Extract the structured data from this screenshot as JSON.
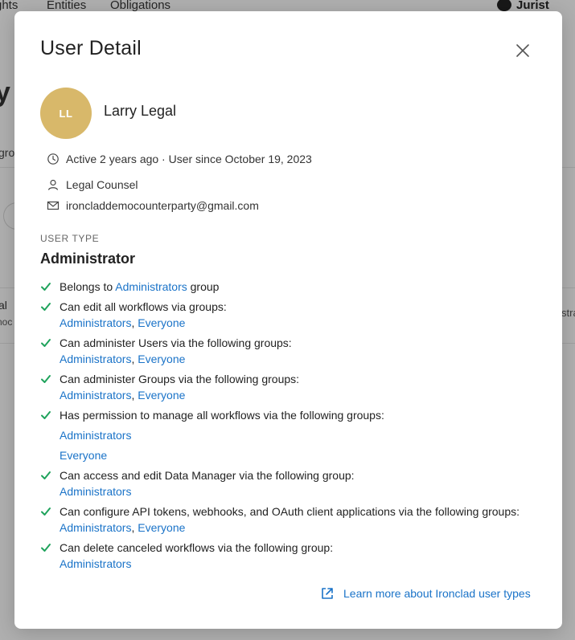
{
  "background": {
    "nav_tabs": [
      "ghts",
      "Entities",
      "Obligations"
    ],
    "account_label": "Jurist",
    "heading_fragment": "y",
    "tab_fragment": "gro",
    "row_label_fragment": "al",
    "row_sub_fragment": "noc",
    "row_right_fragment": "stra"
  },
  "modal": {
    "title": "User Detail",
    "close_icon": "close-icon",
    "user": {
      "initials": "LL",
      "name": "Larry Legal",
      "avatar_color": "#d8b86a",
      "activity": "Active 2 years ago · User since October 19, 2023",
      "role": "Legal Counsel",
      "email": "ironcladdemocounterparty@gmail.com"
    },
    "user_type_label": "USER TYPE",
    "user_type": "Administrator",
    "permissions": [
      {
        "prefix": "Belongs to ",
        "inline_link": "Administrators",
        "suffix": " group"
      },
      {
        "text": "Can edit all workflows via groups:",
        "links": [
          "Administrators",
          "Everyone"
        ]
      },
      {
        "text": "Can administer Users via the following groups:",
        "links": [
          "Administrators",
          "Everyone"
        ]
      },
      {
        "text": "Can administer Groups via the following groups:",
        "links": [
          "Administrators",
          "Everyone"
        ]
      },
      {
        "text": "Has permission to manage all workflows via the following groups:",
        "block_links": [
          "Administrators",
          "Everyone"
        ]
      },
      {
        "text": "Can access and edit Data Manager via the following group:",
        "links": [
          "Administrators"
        ]
      },
      {
        "text": "Can configure API tokens, webhooks, and OAuth client applications via the following groups:",
        "links": [
          "Administrators",
          "Everyone"
        ]
      },
      {
        "text": "Can delete canceled workflows via the following group:",
        "links": [
          "Administrators"
        ]
      }
    ],
    "separator": ", ",
    "learn_more": "Learn more about Ironclad user types",
    "link_color": "#1a73c8",
    "check_color": "#1fa35c"
  }
}
